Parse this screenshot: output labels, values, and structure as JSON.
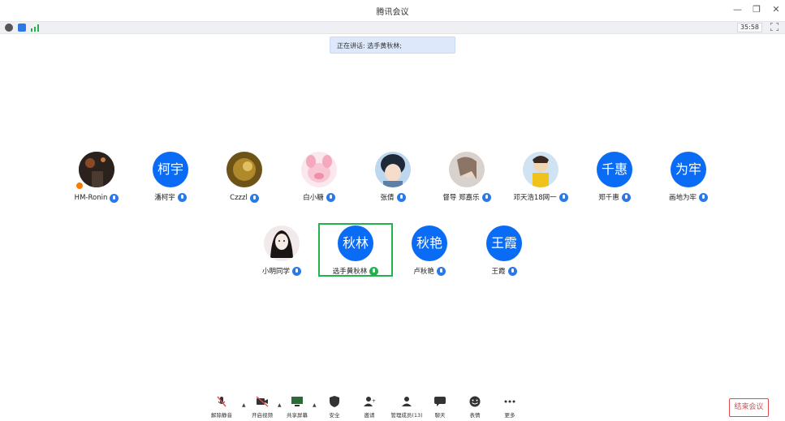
{
  "window": {
    "title": "腾讯会议"
  },
  "statusbar": {
    "timer": "35:58"
  },
  "speaking_banner": "正在讲话: 选手黄秋林;",
  "participants_row1": [
    {
      "name": "HM-Ronin",
      "avatar": "photo-dark",
      "mic": "on",
      "host_badge": true
    },
    {
      "name": "潘柯宇",
      "avatar_text": "柯宇",
      "mic": "on"
    },
    {
      "name": "Czzzl",
      "avatar": "photo-gold",
      "mic": "on"
    },
    {
      "name": "白小糖",
      "avatar": "pink-pig",
      "mic": "on"
    },
    {
      "name": "张倩",
      "avatar": "anime-girl",
      "mic": "on"
    },
    {
      "name": "督导 郑嘉乐",
      "avatar": "photo-girl",
      "mic": "on"
    },
    {
      "name": "邓天浩18网一",
      "avatar": "anime-yellow",
      "mic": "on"
    },
    {
      "name": "郑千惠",
      "avatar_text": "千惠",
      "mic": "on"
    },
    {
      "name": "画地为牢",
      "avatar_text": "为牢",
      "mic": "on"
    }
  ],
  "participants_row2": [
    {
      "name": "小明同学",
      "avatar": "sketch-girl",
      "mic": "on"
    },
    {
      "name": "选手黄秋林",
      "avatar_text": "秋林",
      "mic": "speaking"
    },
    {
      "name": "卢秋艳",
      "avatar_text": "秋艳",
      "mic": "on"
    },
    {
      "name": "王霞",
      "avatar_text": "王霞",
      "mic": "on"
    }
  ],
  "toolbar": {
    "unmute": "解除静音",
    "video": "开启视频",
    "share": "共享屏幕",
    "security": "安全",
    "invite": "邀请",
    "members": "管理成员(13)",
    "chat": "聊天",
    "reactions": "表情",
    "more": "更多",
    "end": "结束会议"
  },
  "colors": {
    "accent": "#0a6cf5",
    "end": "#e5484d",
    "speaking_border": "#24b24f"
  }
}
